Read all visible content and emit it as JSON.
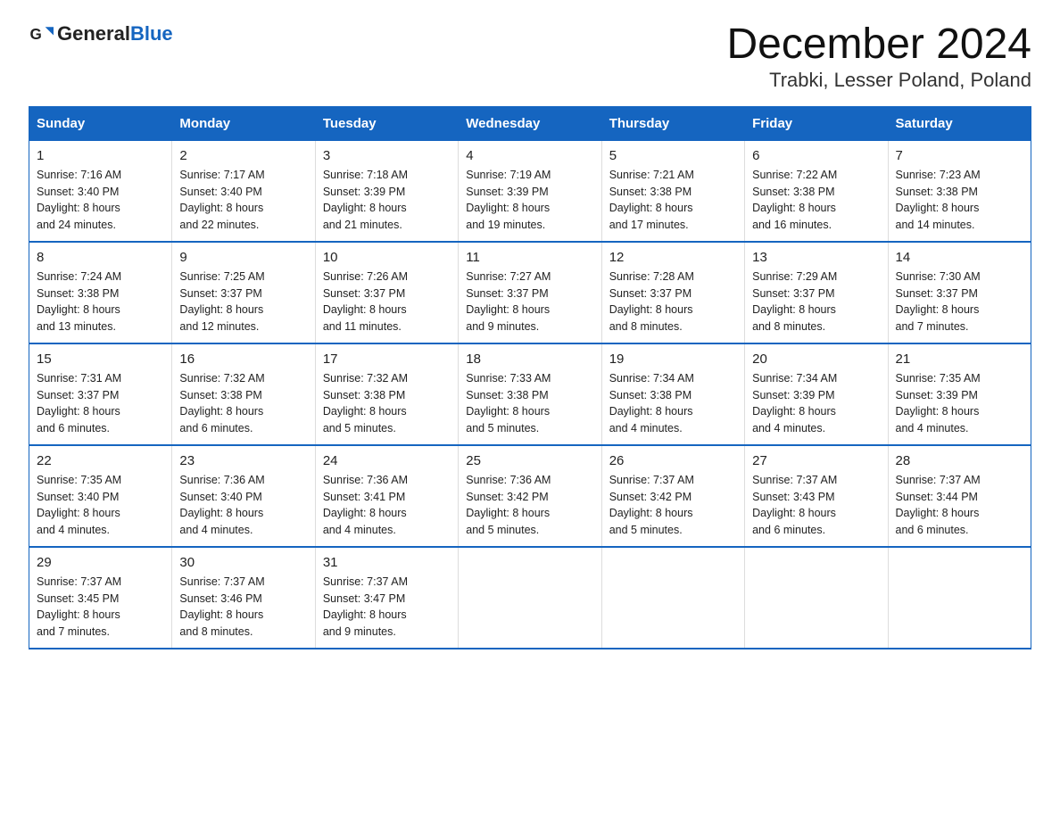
{
  "header": {
    "logo_general": "General",
    "logo_blue": "Blue",
    "month_title": "December 2024",
    "location": "Trabki, Lesser Poland, Poland"
  },
  "weekdays": [
    "Sunday",
    "Monday",
    "Tuesday",
    "Wednesday",
    "Thursday",
    "Friday",
    "Saturday"
  ],
  "weeks": [
    [
      {
        "day": "1",
        "sunrise": "7:16 AM",
        "sunset": "3:40 PM",
        "daylight": "8 hours and 24 minutes."
      },
      {
        "day": "2",
        "sunrise": "7:17 AM",
        "sunset": "3:40 PM",
        "daylight": "8 hours and 22 minutes."
      },
      {
        "day": "3",
        "sunrise": "7:18 AM",
        "sunset": "3:39 PM",
        "daylight": "8 hours and 21 minutes."
      },
      {
        "day": "4",
        "sunrise": "7:19 AM",
        "sunset": "3:39 PM",
        "daylight": "8 hours and 19 minutes."
      },
      {
        "day": "5",
        "sunrise": "7:21 AM",
        "sunset": "3:38 PM",
        "daylight": "8 hours and 17 minutes."
      },
      {
        "day": "6",
        "sunrise": "7:22 AM",
        "sunset": "3:38 PM",
        "daylight": "8 hours and 16 minutes."
      },
      {
        "day": "7",
        "sunrise": "7:23 AM",
        "sunset": "3:38 PM",
        "daylight": "8 hours and 14 minutes."
      }
    ],
    [
      {
        "day": "8",
        "sunrise": "7:24 AM",
        "sunset": "3:38 PM",
        "daylight": "8 hours and 13 minutes."
      },
      {
        "day": "9",
        "sunrise": "7:25 AM",
        "sunset": "3:37 PM",
        "daylight": "8 hours and 12 minutes."
      },
      {
        "day": "10",
        "sunrise": "7:26 AM",
        "sunset": "3:37 PM",
        "daylight": "8 hours and 11 minutes."
      },
      {
        "day": "11",
        "sunrise": "7:27 AM",
        "sunset": "3:37 PM",
        "daylight": "8 hours and 9 minutes."
      },
      {
        "day": "12",
        "sunrise": "7:28 AM",
        "sunset": "3:37 PM",
        "daylight": "8 hours and 8 minutes."
      },
      {
        "day": "13",
        "sunrise": "7:29 AM",
        "sunset": "3:37 PM",
        "daylight": "8 hours and 8 minutes."
      },
      {
        "day": "14",
        "sunrise": "7:30 AM",
        "sunset": "3:37 PM",
        "daylight": "8 hours and 7 minutes."
      }
    ],
    [
      {
        "day": "15",
        "sunrise": "7:31 AM",
        "sunset": "3:37 PM",
        "daylight": "8 hours and 6 minutes."
      },
      {
        "day": "16",
        "sunrise": "7:32 AM",
        "sunset": "3:38 PM",
        "daylight": "8 hours and 6 minutes."
      },
      {
        "day": "17",
        "sunrise": "7:32 AM",
        "sunset": "3:38 PM",
        "daylight": "8 hours and 5 minutes."
      },
      {
        "day": "18",
        "sunrise": "7:33 AM",
        "sunset": "3:38 PM",
        "daylight": "8 hours and 5 minutes."
      },
      {
        "day": "19",
        "sunrise": "7:34 AM",
        "sunset": "3:38 PM",
        "daylight": "8 hours and 4 minutes."
      },
      {
        "day": "20",
        "sunrise": "7:34 AM",
        "sunset": "3:39 PM",
        "daylight": "8 hours and 4 minutes."
      },
      {
        "day": "21",
        "sunrise": "7:35 AM",
        "sunset": "3:39 PM",
        "daylight": "8 hours and 4 minutes."
      }
    ],
    [
      {
        "day": "22",
        "sunrise": "7:35 AM",
        "sunset": "3:40 PM",
        "daylight": "8 hours and 4 minutes."
      },
      {
        "day": "23",
        "sunrise": "7:36 AM",
        "sunset": "3:40 PM",
        "daylight": "8 hours and 4 minutes."
      },
      {
        "day": "24",
        "sunrise": "7:36 AM",
        "sunset": "3:41 PM",
        "daylight": "8 hours and 4 minutes."
      },
      {
        "day": "25",
        "sunrise": "7:36 AM",
        "sunset": "3:42 PM",
        "daylight": "8 hours and 5 minutes."
      },
      {
        "day": "26",
        "sunrise": "7:37 AM",
        "sunset": "3:42 PM",
        "daylight": "8 hours and 5 minutes."
      },
      {
        "day": "27",
        "sunrise": "7:37 AM",
        "sunset": "3:43 PM",
        "daylight": "8 hours and 6 minutes."
      },
      {
        "day": "28",
        "sunrise": "7:37 AM",
        "sunset": "3:44 PM",
        "daylight": "8 hours and 6 minutes."
      }
    ],
    [
      {
        "day": "29",
        "sunrise": "7:37 AM",
        "sunset": "3:45 PM",
        "daylight": "8 hours and 7 minutes."
      },
      {
        "day": "30",
        "sunrise": "7:37 AM",
        "sunset": "3:46 PM",
        "daylight": "8 hours and 8 minutes."
      },
      {
        "day": "31",
        "sunrise": "7:37 AM",
        "sunset": "3:47 PM",
        "daylight": "8 hours and 9 minutes."
      },
      null,
      null,
      null,
      null
    ]
  ],
  "labels": {
    "sunrise_prefix": "Sunrise: ",
    "sunset_prefix": "Sunset: ",
    "daylight_prefix": "Daylight: "
  }
}
